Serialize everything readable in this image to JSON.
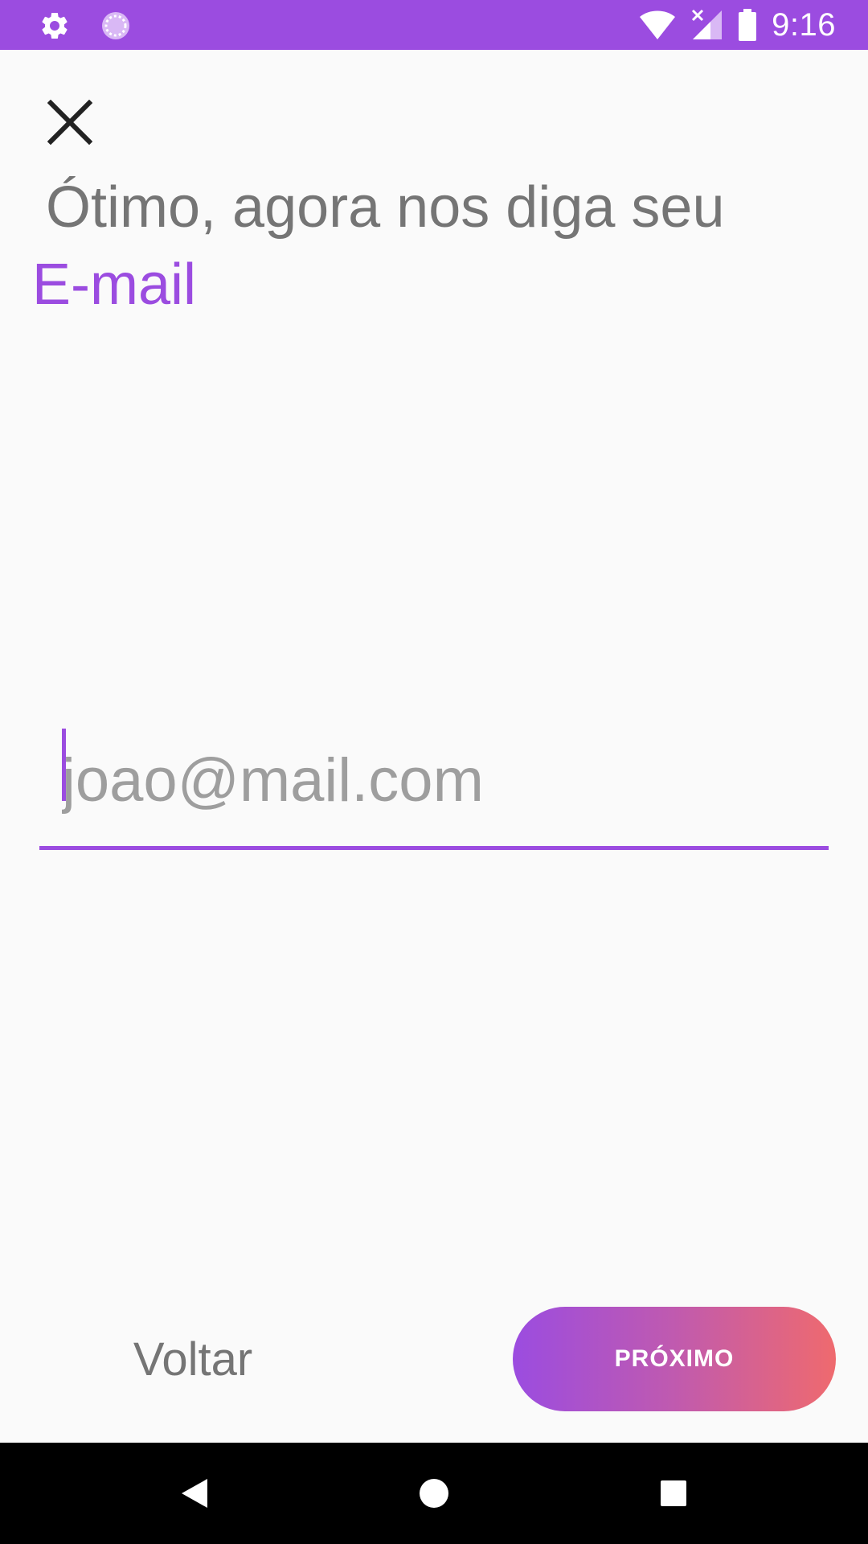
{
  "status_bar": {
    "time": "9:16",
    "background": "#9b4ce0",
    "icons_left": [
      "gear-icon",
      "sync-icon"
    ],
    "icons_right": [
      "wifi-icon",
      "cellular-no-signal-icon",
      "battery-icon"
    ]
  },
  "toolbar": {
    "close_icon": "close-icon"
  },
  "header": {
    "title": "Ótimo, agora nos diga seu",
    "highlight": "E-mail",
    "title_color": "#757575",
    "highlight_color": "#9b4ce0"
  },
  "form": {
    "email": {
      "value": "",
      "placeholder": "joao@mail.com",
      "underline_color": "#9b4ce0"
    }
  },
  "actions": {
    "back_label": "Voltar",
    "next_label": "PRÓXIMO",
    "next_gradient": [
      "#9b4ce0",
      "#ef6a6e"
    ]
  },
  "nav_bar": {
    "icons": [
      "back-triangle-icon",
      "home-circle-icon",
      "recents-square-icon"
    ]
  }
}
